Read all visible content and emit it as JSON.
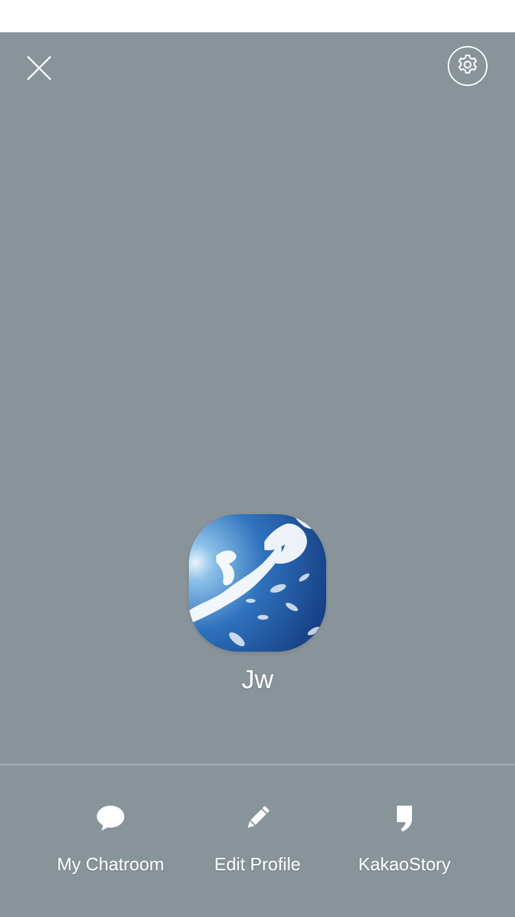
{
  "header": {
    "close_icon": "close-icon",
    "settings_icon": "gear-icon"
  },
  "profile": {
    "name": "Jw",
    "avatar_description": "sky-with-clouds"
  },
  "actions": [
    {
      "label": "My Chatroom",
      "icon": "speech-bubble-icon"
    },
    {
      "label": "Edit Profile",
      "icon": "pencil-icon"
    },
    {
      "label": "KakaoStory",
      "icon": "kakaostory-icon"
    }
  ],
  "colors": {
    "background": "#88939a",
    "foreground": "#ffffff",
    "status_bar": "#ffffff"
  }
}
